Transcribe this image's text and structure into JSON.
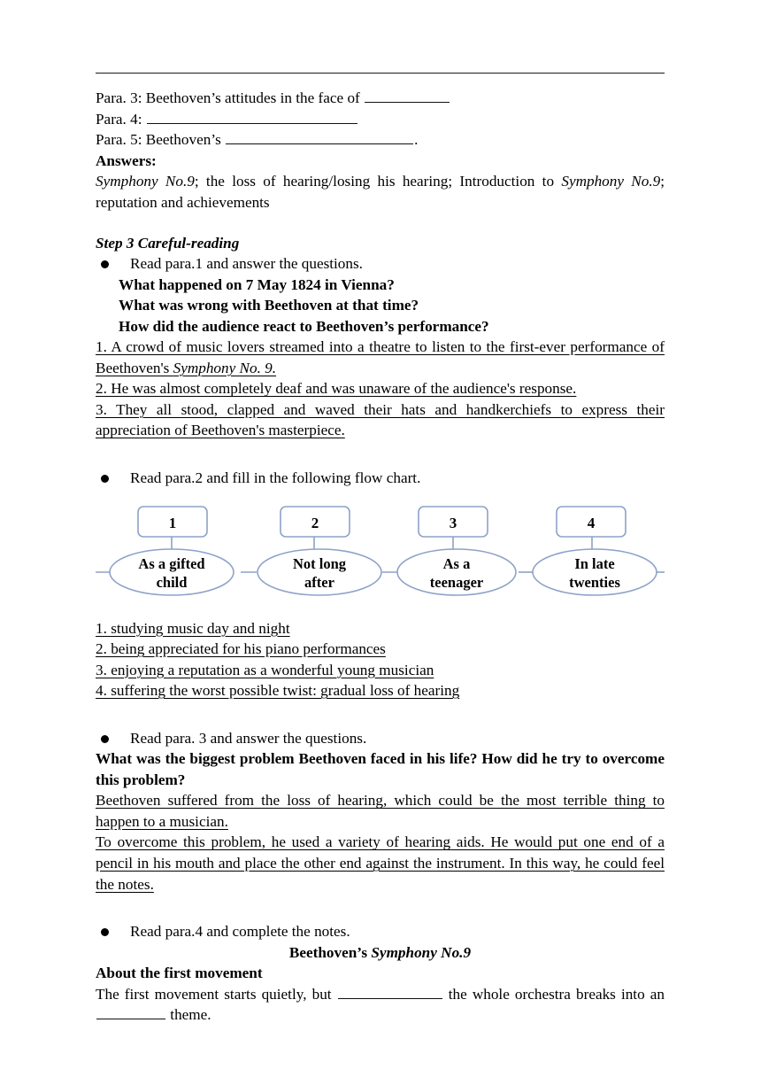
{
  "document": {
    "outline_answers": {
      "para3_prefix": "Para. 3: Beethoven’s attitudes in the face of ",
      "para4_prefix": "Para. 4: ",
      "para5_prefix": "Para. 5: Beethoven’s ",
      "para5_suffix": ".",
      "answers_label": "Answers:",
      "answers_text_1": "Symphony No.9",
      "answers_text_2": "; the loss of hearing/losing his hearing; Introduction to ",
      "answers_text_3": "Symphony No.9",
      "answers_text_4": "; reputation and achievements"
    },
    "step3": {
      "heading": "Step 3 Careful-reading",
      "bullet1": "Read para.1 and answer the questions.",
      "questions": [
        "What happened on 7 May 1824 in Vienna?",
        "What was wrong with Beethoven at that time?",
        "How did the audience react to Beethoven’s performance?"
      ],
      "answer1_a": "1. A crowd of music lovers streamed into a theatre to listen to the first-ever performance of Beethoven's ",
      "answer1_b": "Symphony No. 9.",
      "answer2": "2. He was almost completely deaf and was unaware of the audience's response.",
      "answer3": "3. They all stood, clapped and waved their hats and handkerchiefs to express their appreciation of Beethoven's masterpiece."
    },
    "flow_section": {
      "bullet": "Read para.2 and fill in the following flow chart.",
      "nodes": [
        {
          "number": "1",
          "line1": "As a gifted",
          "line2": "child"
        },
        {
          "number": "2",
          "line1": "Not long",
          "line2": "after"
        },
        {
          "number": "3",
          "line1": "As a",
          "line2": "teenager"
        },
        {
          "number": "4",
          "line1": "In late",
          "line2": "twenties"
        }
      ],
      "answers": [
        "1. studying music day and night",
        "2. being appreciated for his piano performances",
        "3. enjoying a reputation as a wonderful young musician",
        "4. suffering the worst possible twist: gradual loss of hearing"
      ],
      "shape_stroke": "#8ea2c8"
    },
    "para3_section": {
      "bullet": "Read para. 3 and answer the questions.",
      "question": "What was the biggest problem Beethoven faced in his life? How did he try to overcome this problem?",
      "answer_a": "Beethoven suffered from the loss of hearing, which could be the most terrible thing to happen to a musician.",
      "answer_b": "To overcome this problem, he used a variety of hearing aids. He would put one end of a pencil in his mouth and place the other end against the instrument. In this way, he could feel the notes."
    },
    "para4_section": {
      "bullet": "Read para.4 and complete the notes.",
      "title_a": "Beethoven’s ",
      "title_b": "Symphony No.9",
      "subheading": "About the first movement",
      "notes_a": "The first movement starts quietly, but ",
      "notes_b": " the whole orchestra breaks into an ",
      "notes_c": " theme."
    }
  }
}
